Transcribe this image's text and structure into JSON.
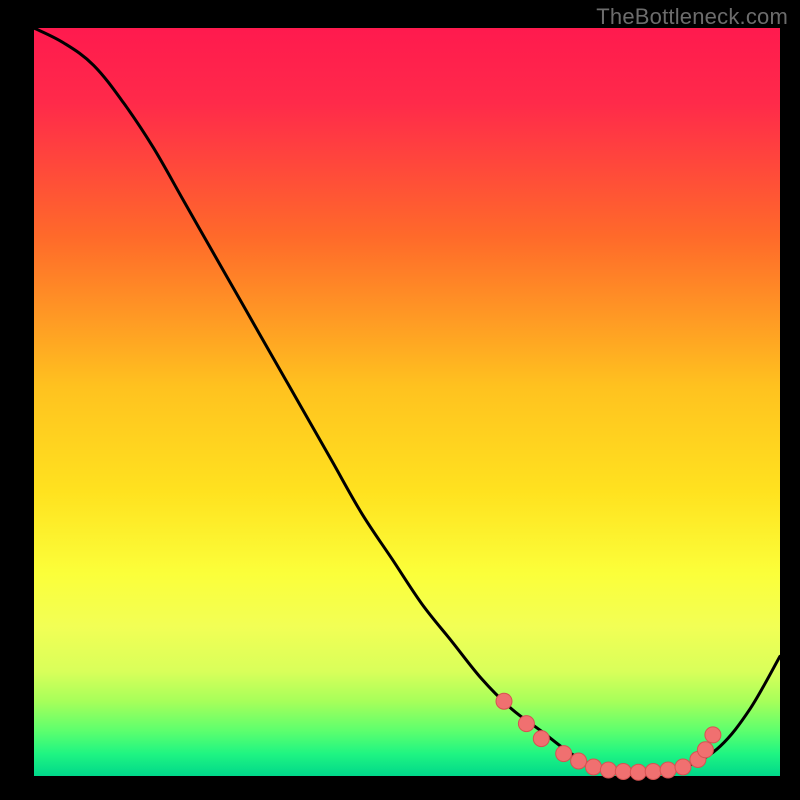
{
  "watermark": "TheBottleneck.com",
  "colors": {
    "black": "#000000",
    "grad_top": "#ff1744",
    "grad_mid1": "#ff6a2a",
    "grad_mid2": "#ffd21f",
    "grad_mid3": "#f6ff4a",
    "grad_band": "#d9ff5a",
    "grad_green1": "#8cff5a",
    "grad_green2": "#35ff7a",
    "grad_green3": "#00e08a",
    "curve": "#000000",
    "dot_fill": "#f07070",
    "dot_stroke": "#d75252",
    "watermark": "#6c6c6c"
  },
  "chart_data": {
    "type": "line",
    "title": "",
    "xlabel": "",
    "ylabel": "",
    "xlim": [
      0,
      100
    ],
    "ylim": [
      0,
      100
    ],
    "grid": false,
    "series": [
      {
        "name": "curve",
        "x": [
          0,
          4,
          8,
          12,
          16,
          20,
          24,
          28,
          32,
          36,
          40,
          44,
          48,
          52,
          56,
          60,
          64,
          68,
          72,
          76,
          80,
          84,
          88,
          92,
          96,
          100
        ],
        "y": [
          100,
          98,
          95,
          90,
          84,
          77,
          70,
          63,
          56,
          49,
          42,
          35,
          29,
          23,
          18,
          13,
          9,
          6,
          3,
          1,
          0.5,
          0.5,
          1.5,
          4,
          9,
          16
        ]
      }
    ],
    "markers": {
      "name": "highlighted-points",
      "x": [
        63,
        66,
        68,
        71,
        73,
        75,
        77,
        79,
        81,
        83,
        85,
        87,
        89,
        90,
        91
      ],
      "y": [
        10,
        7,
        5,
        3,
        2,
        1.2,
        0.8,
        0.6,
        0.5,
        0.6,
        0.8,
        1.2,
        2.2,
        3.5,
        5.5
      ]
    },
    "legend": "none"
  }
}
